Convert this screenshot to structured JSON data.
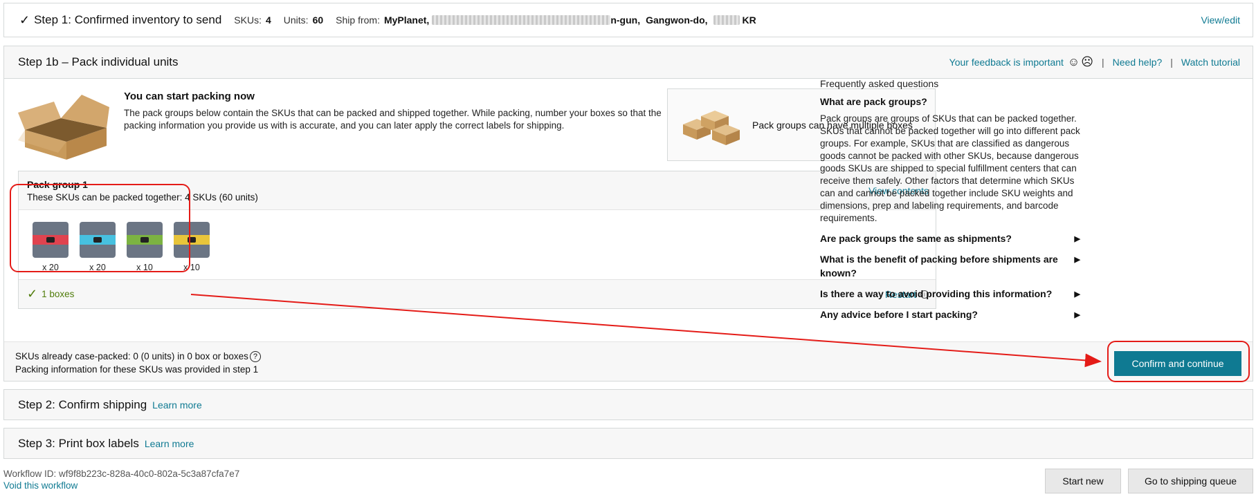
{
  "step1": {
    "title": "Step 1: Confirmed inventory to send",
    "skus_label": "SKUs:",
    "skus_value": "4",
    "units_label": "Units:",
    "units_value": "60",
    "ship_from_label": "Ship from:",
    "ship_name": "MyPlanet,",
    "address_suffix": "n-gun,",
    "region": "Gangwon-do,",
    "country": "KR",
    "view_edit": "View/edit"
  },
  "step1b": {
    "title": "Step 1b – Pack individual units",
    "feedback": "Your feedback is important",
    "help": "Need help?",
    "tutorial": "Watch tutorial"
  },
  "intro": {
    "heading": "You can start packing now",
    "text": "The pack groups below contain the SKUs that can be packed and shipped together. While packing, number your boxes so that the packing information you provide us with is accurate, and you can later apply the correct labels for shipping.",
    "multi_box_text": "Pack groups can have multiple boxes"
  },
  "pack_group": {
    "title": "Pack group 1",
    "subtitle": "These SKUs can be packed together: 4 SKUs (60 units)",
    "view_contents": "View contents",
    "skus": [
      {
        "qty": "x 20",
        "color": "#e0434f"
      },
      {
        "qty": "x 20",
        "color": "#47c1e0"
      },
      {
        "qty": "x 10",
        "color": "#7cb342"
      },
      {
        "qty": "x 10",
        "color": "#e8c53a"
      }
    ],
    "boxes": "1 boxes",
    "restart": "Restart"
  },
  "faq": {
    "heading": "Frequently asked questions",
    "open_question": "What are pack groups?",
    "answer": "Pack groups are groups of SKUs that can be packed together. SKUs that cannot be packed together will go into different pack groups. For example, SKUs that are classified as dangerous goods cannot be packed with other SKUs, because dangerous goods SKUs are shipped to special fulfillment centers that can receive them safely. Other factors that determine which SKUs can and cannot be packed together include SKU weights and dimensions, prep and labeling requirements, and barcode requirements.",
    "questions": [
      "Are pack groups the same as shipments?",
      "What is the benefit of packing before shipments are known?",
      "Is there a way to avoid providing this information?",
      "Any advice before I start packing?"
    ]
  },
  "case_packed": {
    "line1": "SKUs already case-packed: 0 (0 units) in 0 box or boxes",
    "line2": "Packing information for these SKUs was provided in step 1"
  },
  "confirm_button": "Confirm and continue",
  "step2": {
    "title": "Step 2: Confirm shipping",
    "learn": "Learn more"
  },
  "step3": {
    "title": "Step 3: Print box labels",
    "learn": "Learn more"
  },
  "workflow": {
    "id_text": "Workflow ID: wf9f8b223c-828a-40c0-802a-5c3a87cfa7e7",
    "void": "Void this workflow"
  },
  "buttons": {
    "start_new": "Start new",
    "shipping_queue": "Go to shipping queue"
  }
}
